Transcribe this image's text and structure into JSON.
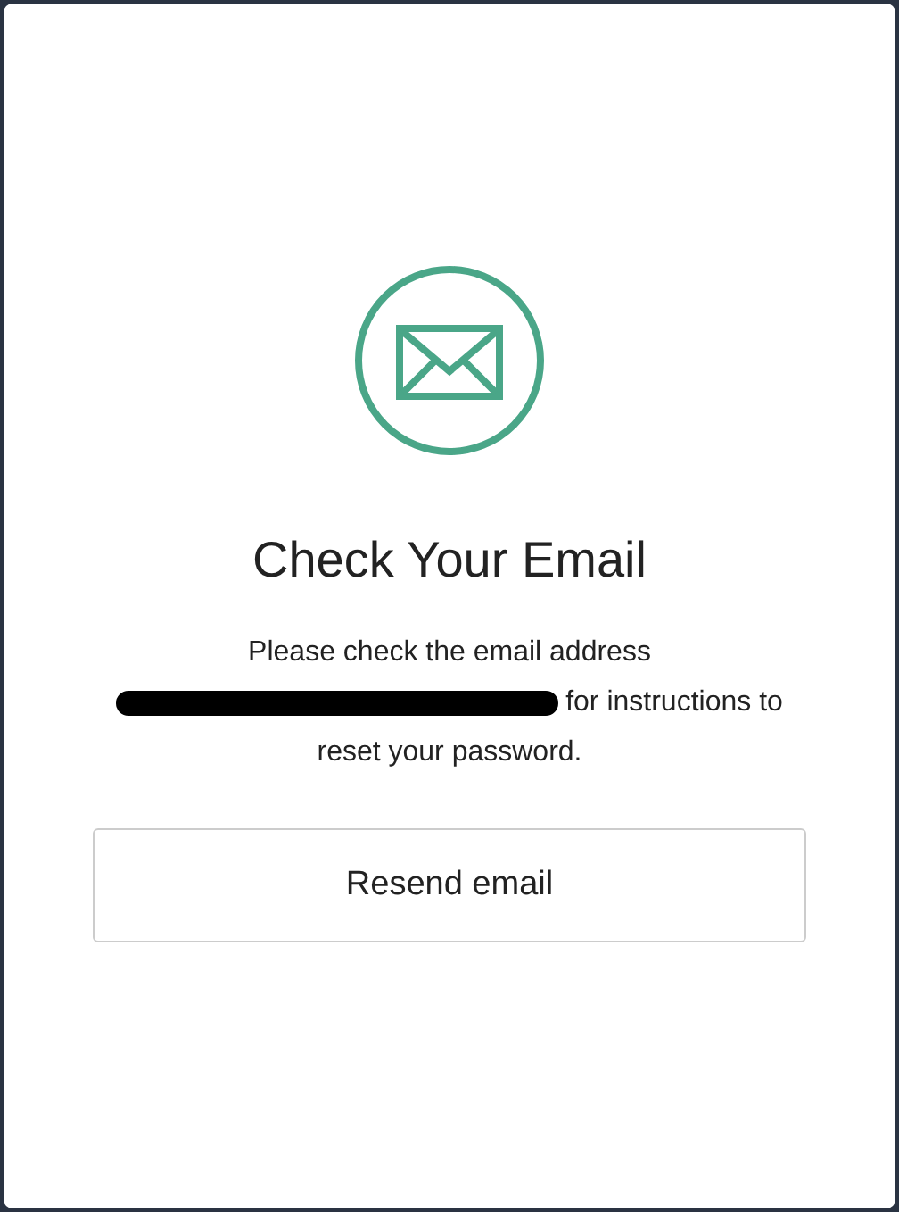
{
  "title": "Check Your Email",
  "message": {
    "before": "Please check the email address",
    "redacted": true,
    "after": "for instructions to reset your password."
  },
  "button": {
    "label": "Resend email"
  }
}
